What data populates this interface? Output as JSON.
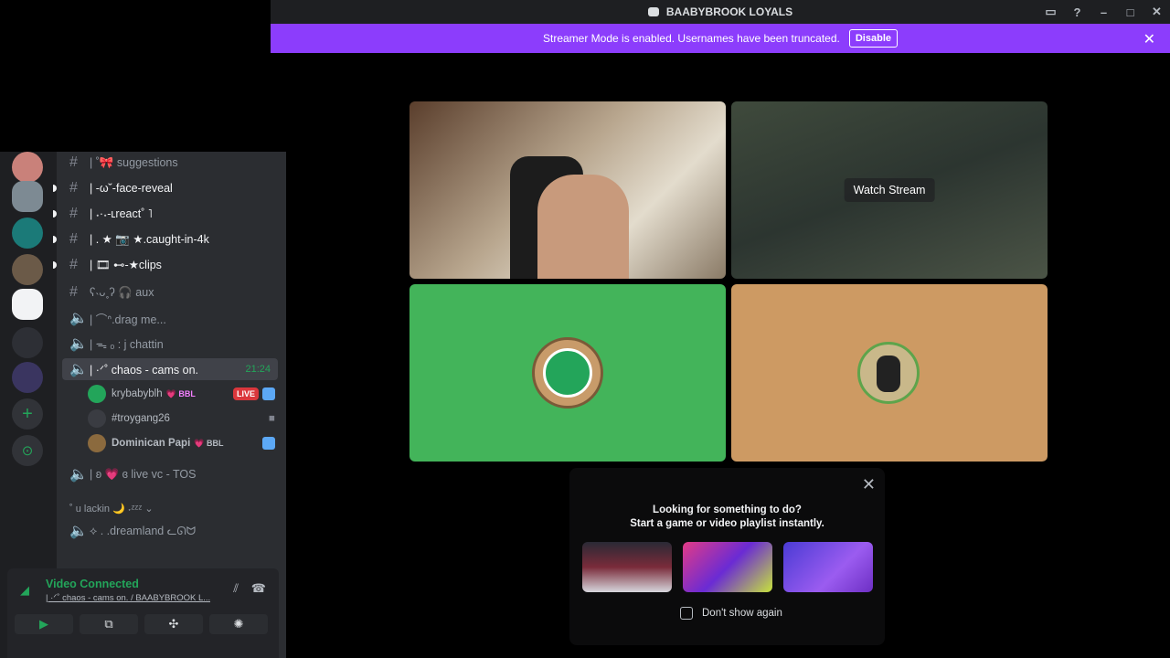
{
  "window": {
    "title": "BAABYBROOK LOYALS"
  },
  "banner": {
    "text": "Streamer Mode is enabled. Usernames have been truncated.",
    "button": "Disable"
  },
  "channels": [
    {
      "label": "| ˚🎀 suggestions",
      "type": "text"
    },
    {
      "label": "| -ω˘-face-reveal",
      "type": "text"
    },
    {
      "label": "| ˖·˖-ʟreact˚ ˥",
      "type": "text"
    },
    {
      "label": "| . ★ 📷 ★.caught-in-4k",
      "type": "text"
    },
    {
      "label": "| 🎞 ⊷-★clips",
      "type": "text"
    },
    {
      "label": "ʕ˴ᴗ˳ʔ 🎧 aux",
      "type": "text"
    },
    {
      "label": "| ⌒ᐢ.drag me...",
      "type": "voice"
    },
    {
      "label": "| ᯓ ₒ : j chattin",
      "type": "voice"
    },
    {
      "label": "| ·ᐟ˚ chaos - cams on.",
      "type": "voice",
      "time": "21:24"
    },
    {
      "label": "| ʚ 💗 ɞ live vc - TOS",
      "type": "voice"
    },
    {
      "label": "˚ u lackin 🌙 ˖ᶻᶻᶻ ⌄",
      "type": "category"
    },
    {
      "label": "⟡ . .dreamland ᓚᘏᗢ",
      "type": "voice"
    }
  ],
  "voice_users": [
    {
      "name": "krybabyblh",
      "tag": "💗 BBL",
      "badge": "LIVE"
    },
    {
      "name": "#troygang26",
      "tag": "",
      "badge": ""
    },
    {
      "name": "Dominican Papi",
      "tag": "💗 BBL",
      "badge": ""
    }
  ],
  "voice_panel": {
    "status": "Video Connected",
    "channel": "| ·ᐟ˚ chaos - cams on. / BAABYBROOK L..."
  },
  "stage": {
    "watch_label": "Watch Stream"
  },
  "activity_popup": {
    "line1": "Looking for something to do?",
    "line2": "Start a game or video playlist instantly.",
    "checkbox": "Don't show again"
  },
  "colors": {
    "accent": "#8c3dfc",
    "connected": "#23a55a",
    "green_tile": "#43b45a",
    "tan_tile": "#cd9a63"
  }
}
